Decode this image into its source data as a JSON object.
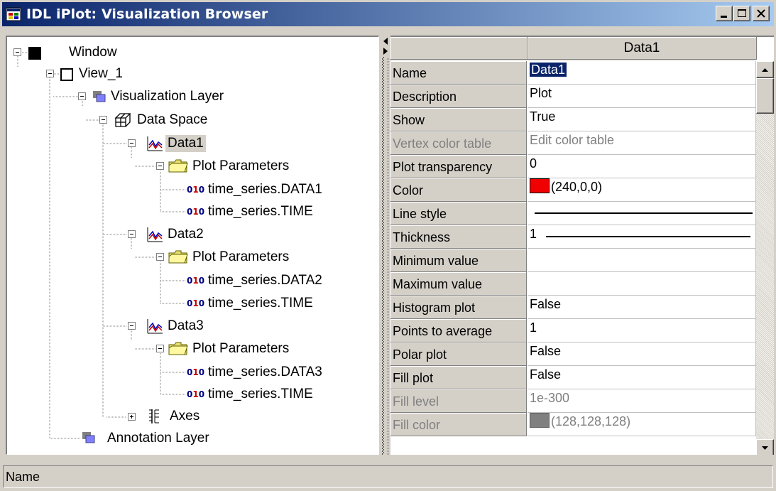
{
  "window": {
    "title": "IDL iPlot: Visualization Browser"
  },
  "tree": {
    "nodes": {
      "window": "Window",
      "view": "View_1",
      "vis_layer": "Visualization Layer",
      "data_space": "Data Space",
      "data1": "Data1",
      "data1_params": "Plot Parameters",
      "data1_p1": "time_series.DATA1",
      "data1_p2": "time_series.TIME",
      "data2": "Data2",
      "data2_params": "Plot Parameters",
      "data2_p1": "time_series.DATA2",
      "data2_p2": "time_series.TIME",
      "data3": "Data3",
      "data3_params": "Plot Parameters",
      "data3_p1": "time_series.DATA3",
      "data3_p2": "time_series.TIME",
      "axes": "Axes",
      "annotation_layer": "Annotation Layer"
    },
    "binary_glyph": {
      "zero1": "0",
      "one": "1",
      "zero2": "0"
    }
  },
  "grid": {
    "column_header": "Data1",
    "rows": [
      {
        "name": "Name",
        "value": "Data1"
      },
      {
        "name": "Description",
        "value": "Plot"
      },
      {
        "name": "Show",
        "value": "True"
      },
      {
        "name": "Vertex color table",
        "value": "Edit color table"
      },
      {
        "name": "Plot transparency",
        "value": "0"
      },
      {
        "name": "Color",
        "value": "(240,0,0)"
      },
      {
        "name": "Line style",
        "value": ""
      },
      {
        "name": "Thickness",
        "value": "1"
      },
      {
        "name": "Minimum value",
        "value": ""
      },
      {
        "name": "Maximum value",
        "value": ""
      },
      {
        "name": "Histogram plot",
        "value": "False"
      },
      {
        "name": "Points to average",
        "value": "1"
      },
      {
        "name": "Polar plot",
        "value": "False"
      },
      {
        "name": "Fill plot",
        "value": "False"
      },
      {
        "name": "Fill level",
        "value": "1e-300"
      },
      {
        "name": "Fill color",
        "value": "(128,128,128)"
      }
    ],
    "colors": {
      "color_swatch": "#f00000",
      "fill_color_swatch": "#808080"
    }
  },
  "status": {
    "text": "Name"
  }
}
